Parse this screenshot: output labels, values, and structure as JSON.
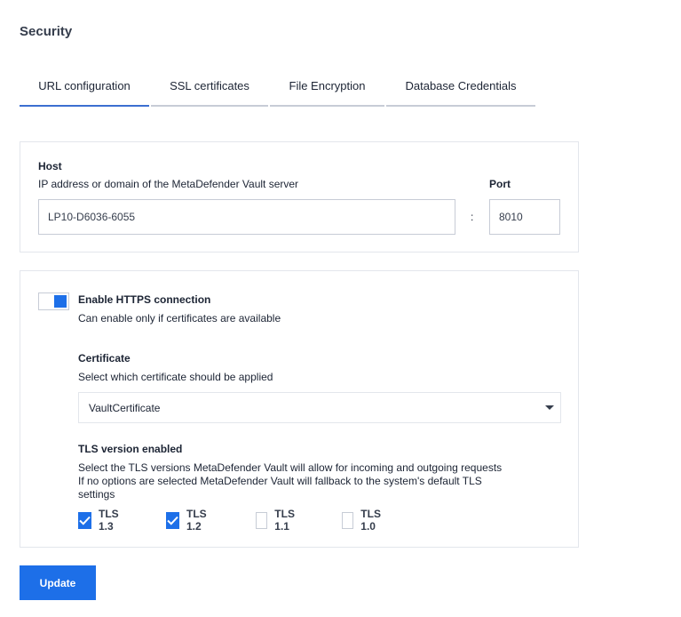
{
  "page": {
    "title": "Security"
  },
  "tabs": [
    {
      "label": "URL configuration",
      "active": true
    },
    {
      "label": "SSL certificates",
      "active": false
    },
    {
      "label": "File Encryption",
      "active": false
    },
    {
      "label": "Database Credentials",
      "active": false
    }
  ],
  "host": {
    "label": "Host",
    "description": "IP address or domain of the MetaDefender Vault server",
    "value": "LP10-D6036-6055",
    "separator": ":",
    "port_label": "Port",
    "port_value": "8010"
  },
  "https": {
    "toggle_label": "Enable HTTPS connection",
    "toggle_on": true,
    "toggle_description": "Can enable only if certificates are available",
    "certificate_label": "Certificate",
    "certificate_description": "Select which certificate should be applied",
    "certificate_value": "VaultCertificate",
    "tls_label": "TLS version enabled",
    "tls_description_1": "Select the TLS versions MetaDefender Vault will allow for incoming and outgoing requests",
    "tls_description_2": "If no options are selected MetaDefender Vault will fallback to the system's default TLS",
    "tls_description_3": "settings",
    "tls_options": [
      {
        "label": "TLS 1.3",
        "checked": true
      },
      {
        "label": "TLS 1.2",
        "checked": true
      },
      {
        "label": "TLS 1.1",
        "checked": false
      },
      {
        "label": "TLS 1.0",
        "checked": false
      }
    ]
  },
  "actions": {
    "update_label": "Update"
  },
  "colors": {
    "accent": "#1d6fe8",
    "tab_active": "#3c6fd1",
    "border": "#c7ccd6",
    "text": "#1c2434"
  }
}
